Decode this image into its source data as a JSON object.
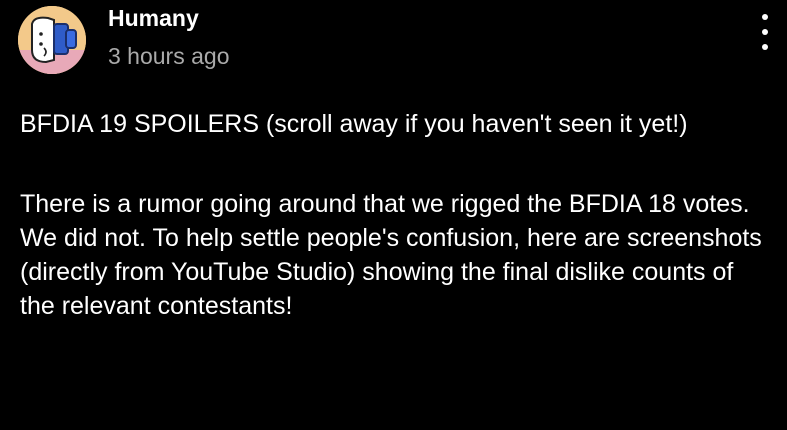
{
  "post": {
    "author": "Humany",
    "timestamp": "3 hours ago",
    "avatar_icon": "character-avatar-icon",
    "more_icon": "more-options-icon",
    "paragraphs": [
      "BFDIA 19 SPOILERS (scroll away if you haven't seen it yet!)",
      "There is a rumor going around that we rigged the BFDIA 18 votes. We did not. To help settle people's confusion, here are screenshots (directly from YouTube Studio) showing the final dislike counts of the relevant contestants!"
    ]
  },
  "colors": {
    "background": "#000000",
    "text": "#ffffff",
    "secondary_text": "#aaaaaa",
    "avatar_bg": "#f3c98a"
  }
}
